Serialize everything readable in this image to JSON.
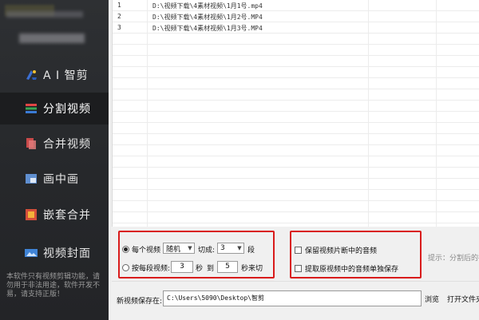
{
  "sidebar": {
    "items": [
      {
        "label": "A I 智剪",
        "icon": "ai-cut-icon"
      },
      {
        "label": "分割视频",
        "icon": "split-video-icon",
        "active": true
      },
      {
        "label": "合并视频",
        "icon": "merge-video-icon"
      },
      {
        "label": "画中画",
        "icon": "picture-in-picture-icon"
      },
      {
        "label": "嵌套合并",
        "icon": "nested-merge-icon"
      },
      {
        "label": "视频封面",
        "icon": "video-cover-icon"
      }
    ],
    "note": "本软件只有视频剪辑功能，请勿用于非法用途，软件开发不易，请支持正版！"
  },
  "file_list": [
    {
      "index": "1",
      "path": "D:\\视频下载\\4素材视频\\1月1号.mp4"
    },
    {
      "index": "2",
      "path": "D:\\视频下载\\4素材视频\\1月2号.MP4"
    },
    {
      "index": "3",
      "path": "D:\\视频下载\\4素材视频\\1月3号.MP4"
    }
  ],
  "options": {
    "per_video_label": "每个视频",
    "mode_value": "随机",
    "cut_into_label": "切成:",
    "segments_value": "3",
    "segments_unit": "段",
    "by_time_label": "按每段视频:",
    "from_value": "3",
    "sec_label": "秒",
    "to_label": "到",
    "to_value": "5",
    "end_label": "秒来切",
    "keep_audio_label": "保留视频片断中的音频",
    "extract_audio_label": "提取原视频中的音频单独保存",
    "hint": "提示：分割后的视"
  },
  "save": {
    "label": "新视频保存在:",
    "path": "C:\\Users\\5090\\Desktop\\智剪",
    "browse_label": "浏览",
    "open_label": "打开文件夹"
  },
  "colors": {
    "sidebar_bg": "#2b2d30",
    "active_bg": "#1c1d1f",
    "highlight_red": "#d91b1b"
  }
}
